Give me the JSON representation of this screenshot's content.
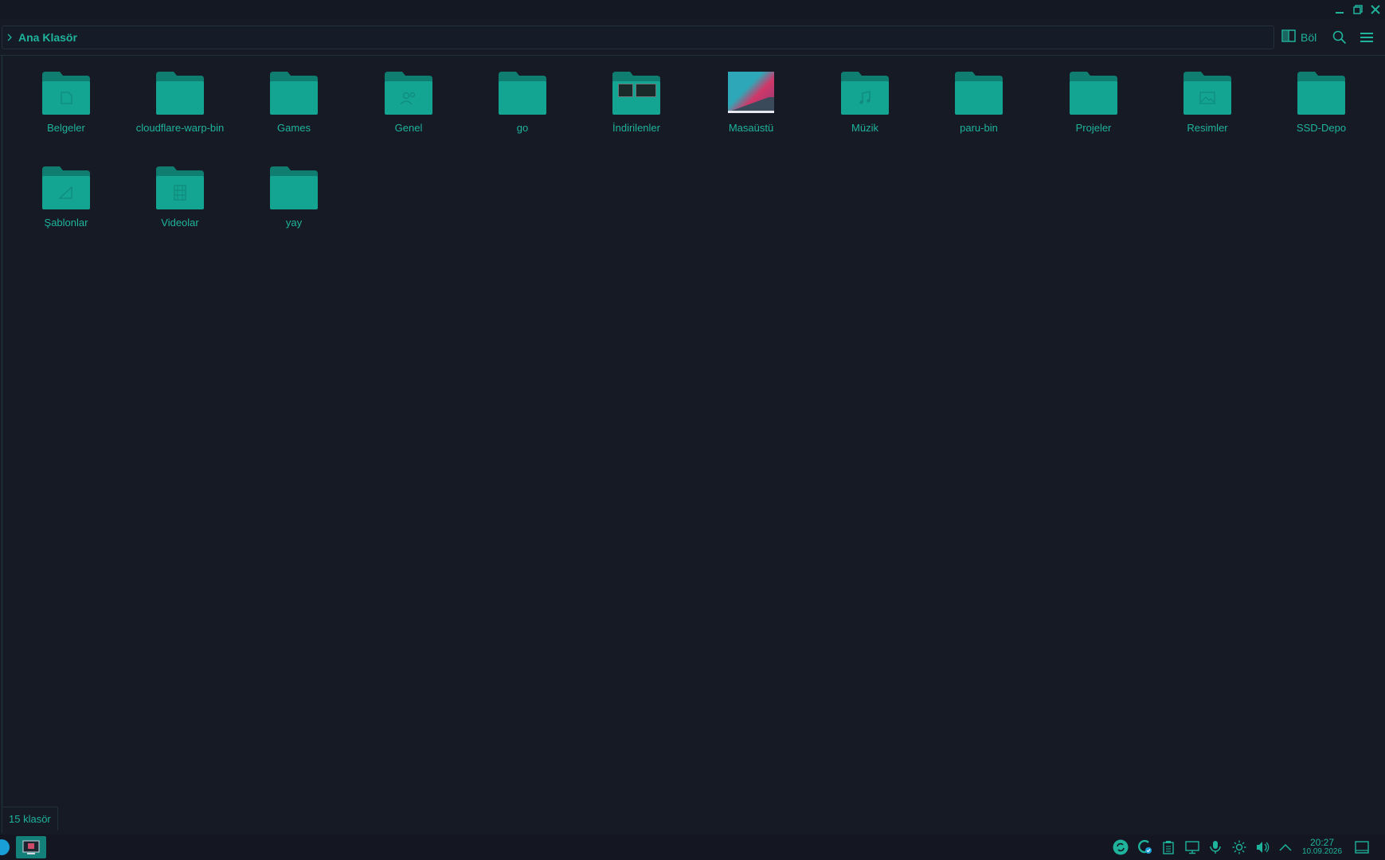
{
  "window": {
    "controls": [
      "minimize-icon",
      "restore-icon",
      "close-icon"
    ]
  },
  "toolbar": {
    "breadcrumb": "Ana Klasör",
    "split_label": "Böl",
    "search_icon": "search-icon",
    "menu_icon": "hamburger-menu-icon"
  },
  "items": [
    {
      "name": "Belgeler",
      "kind": "folder",
      "emblem": "document-icon"
    },
    {
      "name": "cloudflare-warp-bin",
      "kind": "folder",
      "emblem": ""
    },
    {
      "name": "Games",
      "kind": "folder",
      "emblem": ""
    },
    {
      "name": "Genel",
      "kind": "folder",
      "emblem": "users-icon"
    },
    {
      "name": "go",
      "kind": "folder",
      "emblem": ""
    },
    {
      "name": "İndirilenler",
      "kind": "folder",
      "emblem": "preview-thumbnails"
    },
    {
      "name": "Masaüstü",
      "kind": "desktop",
      "emblem": "wallpaper-preview"
    },
    {
      "name": "Müzik",
      "kind": "folder",
      "emblem": "music-icon"
    },
    {
      "name": "paru-bin",
      "kind": "folder",
      "emblem": ""
    },
    {
      "name": "Projeler",
      "kind": "folder",
      "emblem": ""
    },
    {
      "name": "Resimler",
      "kind": "folder",
      "emblem": "image-icon"
    },
    {
      "name": "SSD-Depo",
      "kind": "folder",
      "emblem": ""
    },
    {
      "name": "Şablonlar",
      "kind": "folder",
      "emblem": "template-icon"
    },
    {
      "name": "Videolar",
      "kind": "folder",
      "emblem": "film-icon"
    },
    {
      "name": "yay",
      "kind": "folder",
      "emblem": ""
    }
  ],
  "status": {
    "summary": "15 klasör"
  },
  "taskbar": {
    "clock_time": "20:27",
    "clock_date": "10.09.2026",
    "tray_icons": [
      "sync-icon",
      "update-icon",
      "clipboard-icon",
      "network-icon",
      "microphone-icon",
      "brightness-icon",
      "volume-icon",
      "chevron-up-icon",
      "show-desktop-icon"
    ]
  },
  "colors": {
    "accent": "#1fb39c",
    "folder": "#13a592",
    "folder_tab": "#0f7d70",
    "background": "#161a25"
  }
}
